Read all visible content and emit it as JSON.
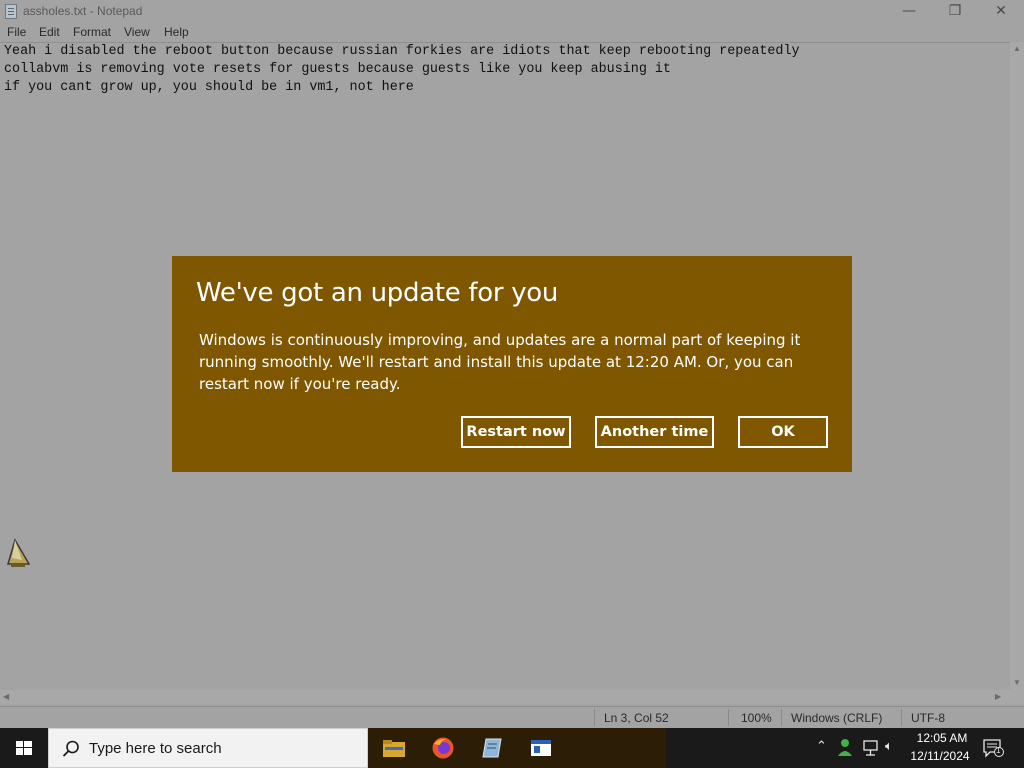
{
  "notepad": {
    "title": "assholes.txt - Notepad",
    "menu": [
      "File",
      "Edit",
      "Format",
      "View",
      "Help"
    ],
    "lines": [
      "Yeah i disabled the reboot button because russian forkies are idiots that keep rebooting repeatedly",
      "collabvm is removing vote resets for guests because guests like you keep abusing it",
      "if you cant grow up, you should be in vm1, not here"
    ],
    "status": {
      "position": "Ln 3, Col 52",
      "zoom": "100%",
      "line_ending": "Windows (CRLF)",
      "encoding": "UTF-8"
    },
    "controls": {
      "minimize": "—",
      "maximize": "❐",
      "close": "✕"
    }
  },
  "dialog": {
    "title": "We've got an update for you",
    "body": "Windows is continuously improving, and updates are a normal part of keeping it running smoothly. We'll restart and install this update at 12:20 AM. Or, you can restart now if you're ready.",
    "buttons": {
      "restart": "Restart now",
      "another": "Another time",
      "ok": "OK"
    },
    "accent_color": "#7f5700"
  },
  "taskbar": {
    "search_placeholder": "Type here to search",
    "pinned": [
      "file-explorer-icon",
      "firefox-icon",
      "notepad-icon",
      "window-app-icon"
    ],
    "tray": [
      "chevron-up-icon",
      "user-icon",
      "network-icon",
      "volume-icon"
    ],
    "time": "12:05 AM",
    "date": "12/11/2024",
    "notification_count": "1"
  }
}
